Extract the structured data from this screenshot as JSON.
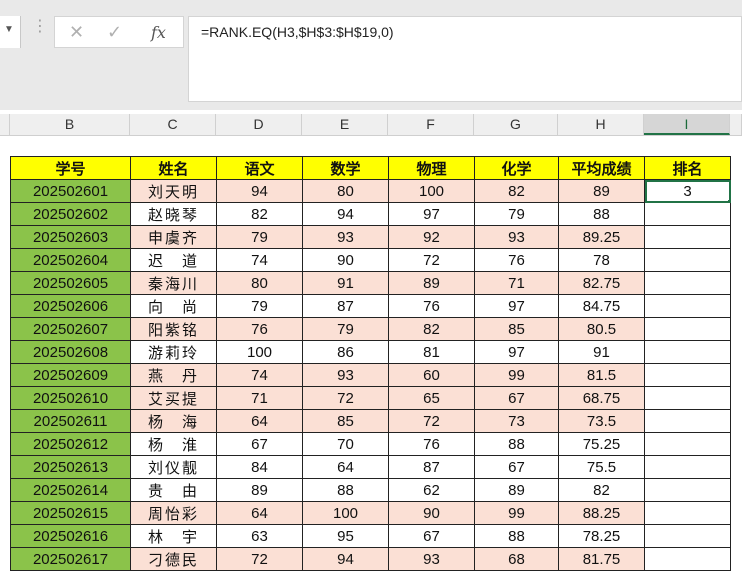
{
  "formula_bar": {
    "formula": "=RANK.EQ(H3,$H$3:$H$19,0)",
    "cancel_icon": "✕",
    "enter_icon": "✓",
    "fx_icon": "fx"
  },
  "column_headers": [
    "B",
    "C",
    "D",
    "E",
    "F",
    "G",
    "H",
    "I"
  ],
  "table": {
    "headers": [
      "学号",
      "姓名",
      "语文",
      "数学",
      "物理",
      "化学",
      "平均成绩",
      "排名"
    ],
    "rows": [
      {
        "id": "202502601",
        "name": "刘天明",
        "yw": "94",
        "sx": "80",
        "wl": "100",
        "hx": "82",
        "avg": "89",
        "rank": "3"
      },
      {
        "id": "202502602",
        "name": "赵晓琴",
        "yw": "82",
        "sx": "94",
        "wl": "97",
        "hx": "79",
        "avg": "88",
        "rank": ""
      },
      {
        "id": "202502603",
        "name": "申虞齐",
        "yw": "79",
        "sx": "93",
        "wl": "92",
        "hx": "93",
        "avg": "89.25",
        "rank": ""
      },
      {
        "id": "202502604",
        "name": "迟　道",
        "yw": "74",
        "sx": "90",
        "wl": "72",
        "hx": "76",
        "avg": "78",
        "rank": ""
      },
      {
        "id": "202502605",
        "name": "秦海川",
        "yw": "80",
        "sx": "91",
        "wl": "89",
        "hx": "71",
        "avg": "82.75",
        "rank": ""
      },
      {
        "id": "202502606",
        "name": "向　尚",
        "yw": "79",
        "sx": "87",
        "wl": "76",
        "hx": "97",
        "avg": "84.75",
        "rank": ""
      },
      {
        "id": "202502607",
        "name": "阳紫铭",
        "yw": "76",
        "sx": "79",
        "wl": "82",
        "hx": "85",
        "avg": "80.5",
        "rank": ""
      },
      {
        "id": "202502608",
        "name": "游莉玲",
        "yw": "100",
        "sx": "86",
        "wl": "81",
        "hx": "97",
        "avg": "91",
        "rank": ""
      },
      {
        "id": "202502609",
        "name": "燕　丹",
        "yw": "74",
        "sx": "93",
        "wl": "60",
        "hx": "99",
        "avg": "81.5",
        "rank": ""
      },
      {
        "id": "202502610",
        "name": "艾买提",
        "yw": "71",
        "sx": "72",
        "wl": "65",
        "hx": "67",
        "avg": "68.75",
        "rank": ""
      },
      {
        "id": "202502611",
        "name": "杨　海",
        "yw": "64",
        "sx": "85",
        "wl": "72",
        "hx": "73",
        "avg": "73.5",
        "rank": ""
      },
      {
        "id": "202502612",
        "name": "杨　淮",
        "yw": "67",
        "sx": "70",
        "wl": "76",
        "hx": "88",
        "avg": "75.25",
        "rank": ""
      },
      {
        "id": "202502613",
        "name": "刘仪靓",
        "yw": "84",
        "sx": "64",
        "wl": "87",
        "hx": "67",
        "avg": "75.5",
        "rank": ""
      },
      {
        "id": "202502614",
        "name": "贵　由",
        "yw": "89",
        "sx": "88",
        "wl": "62",
        "hx": "89",
        "avg": "82",
        "rank": ""
      },
      {
        "id": "202502615",
        "name": "周怡彩",
        "yw": "64",
        "sx": "100",
        "wl": "90",
        "hx": "99",
        "avg": "88.25",
        "rank": ""
      },
      {
        "id": "202502616",
        "name": "林　宇",
        "yw": "63",
        "sx": "95",
        "wl": "67",
        "hx": "88",
        "avg": "78.25",
        "rank": ""
      },
      {
        "id": "202502617",
        "name": "刁德民",
        "yw": "72",
        "sx": "94",
        "wl": "93",
        "hx": "68",
        "avg": "81.75",
        "rank": ""
      }
    ]
  },
  "colors": {
    "header_fill": "#ffff00",
    "id_fill": "#8bc34a",
    "stripe_fill": "#fbe0d5",
    "selection": "#217346"
  }
}
